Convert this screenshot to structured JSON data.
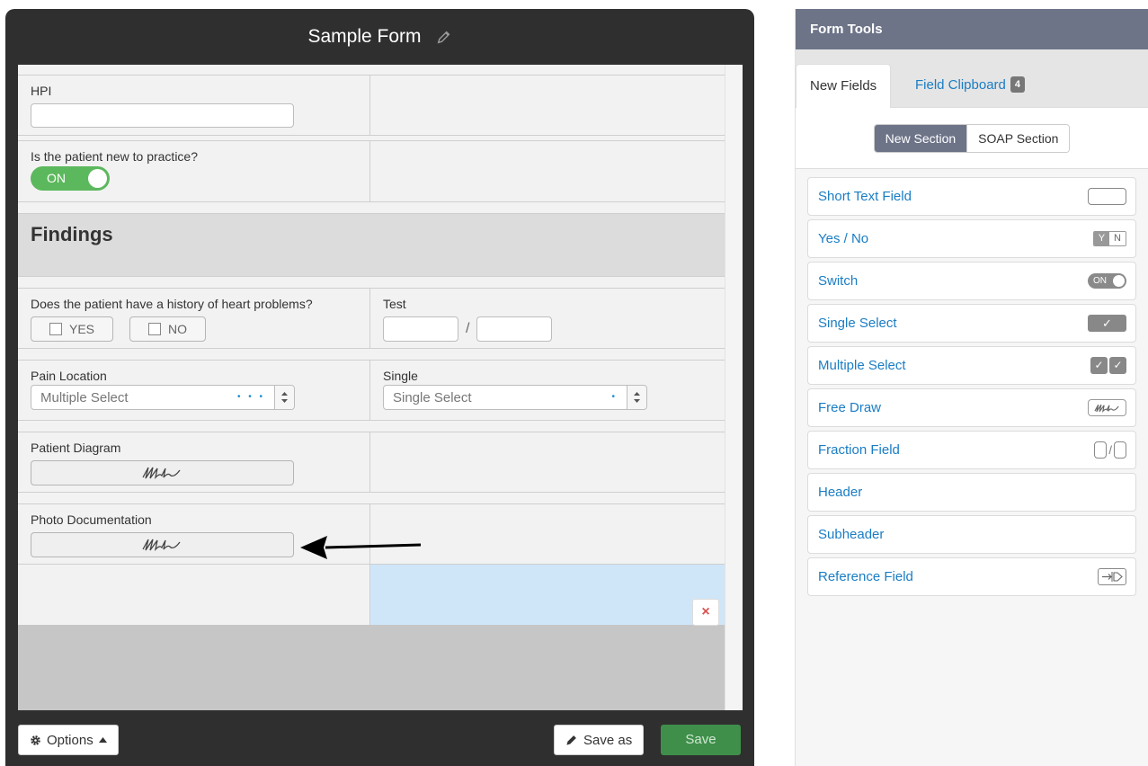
{
  "form": {
    "title": "Sample Form",
    "rows": {
      "hpi": {
        "label": "HPI",
        "value": ""
      },
      "new_patient": {
        "label": "Is the patient new to practice?",
        "toggle": "ON"
      },
      "findings": {
        "title": "Findings"
      },
      "heart": {
        "label": "Does the patient have a history of heart problems?",
        "yes": "YES",
        "no": "NO"
      },
      "test": {
        "label": "Test",
        "separator": "/"
      },
      "pain": {
        "label": "Pain Location",
        "value": "Multiple Select",
        "indicator": "• • •"
      },
      "single": {
        "label": "Single",
        "value": "Single Select",
        "indicator": "•"
      },
      "diagram": {
        "label": "Patient Diagram"
      },
      "photo": {
        "label": "Photo Documentation"
      }
    },
    "delete_icon": "×",
    "footer": {
      "options": "Options",
      "save_as": "Save as",
      "save": "Save"
    }
  },
  "tools": {
    "title": "Form Tools",
    "tabs": {
      "new_fields": "New Fields",
      "clipboard": "Field Clipboard",
      "clipboard_count": "4"
    },
    "section_buttons": {
      "new_section": "New Section",
      "soap_section": "SOAP Section"
    },
    "fields": [
      {
        "label": "Short Text Field",
        "icon": "text-box-icon"
      },
      {
        "label": "Yes / No",
        "icon": "yes-no-icon",
        "icon_text": [
          "Y",
          "N"
        ]
      },
      {
        "label": "Switch",
        "icon": "switch-icon",
        "icon_text": "ON"
      },
      {
        "label": "Single Select",
        "icon": "check-icon",
        "icon_text": "✓"
      },
      {
        "label": "Multiple Select",
        "icon": "double-check-icon",
        "icon_text": "✓"
      },
      {
        "label": "Free Draw",
        "icon": "scribble-icon"
      },
      {
        "label": "Fraction Field",
        "icon": "fraction-icon",
        "icon_text": "/"
      },
      {
        "label": "Header",
        "icon": ""
      },
      {
        "label": "Subheader",
        "icon": ""
      },
      {
        "label": "Reference Field",
        "icon": "reference-icon"
      }
    ]
  },
  "colors": {
    "title_bar": "#2f2f2f",
    "tools_header": "#6d7488",
    "link_blue": "#1a7dc4",
    "toggle_green": "#5cb85c",
    "save_green": "#3f8f4a",
    "selected_cell": "#cfe6f8"
  }
}
